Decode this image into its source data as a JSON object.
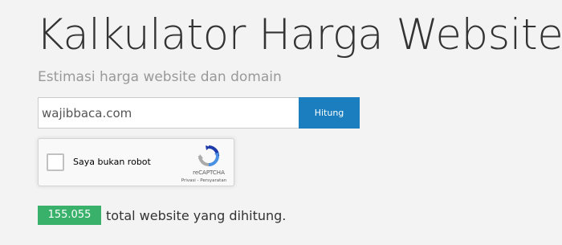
{
  "page": {
    "title": "Kalkulator Harga Website",
    "subtitle": "Estimasi harga website dan domain"
  },
  "form": {
    "domain_value": "wajibbaca.com",
    "submit_label": "Hitung"
  },
  "recaptcha": {
    "checkbox_label": "Saya bukan robot",
    "brand": "reCAPTCHA",
    "links": "Privasi - Persyaratan",
    "icon": "recaptcha-logo-icon"
  },
  "stats": {
    "count": "155.055",
    "label": "total website yang dihitung.",
    "badge_color": "#3ab16a"
  },
  "colors": {
    "accent": "#1b7fbf",
    "background": "#f3f3f3"
  }
}
